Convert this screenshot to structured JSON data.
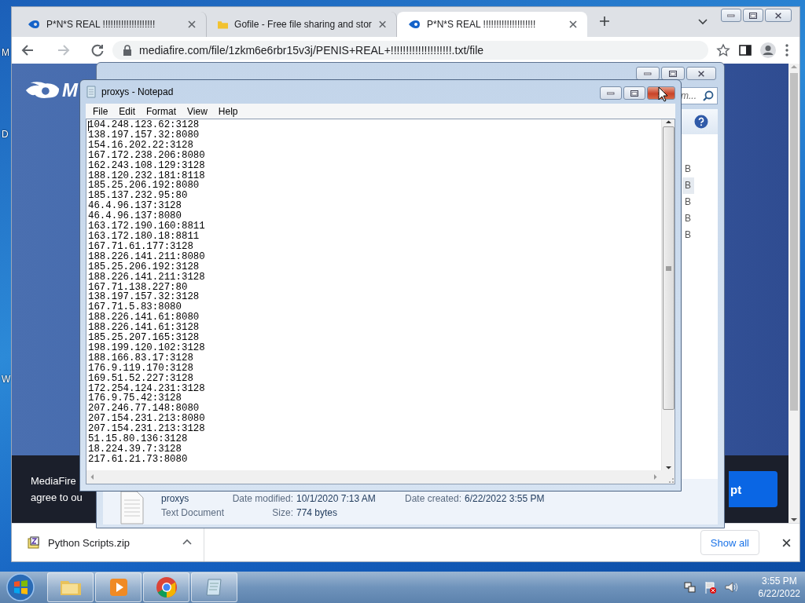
{
  "desktop": {
    "icon_labels": [
      "M",
      "D",
      "W"
    ]
  },
  "browser": {
    "tabs": [
      {
        "title": "P*N*S REAL !!!!!!!!!!!!!!!!!!!!",
        "selected": false,
        "kind": "mediafire"
      },
      {
        "title": "Gofile - Free file sharing and stor",
        "selected": false,
        "kind": "folder"
      },
      {
        "title": "P*N*S REAL !!!!!!!!!!!!!!!!!!!!",
        "selected": true,
        "kind": "mediafire"
      }
    ],
    "url": "mediafire.com/file/1zkm6e6rbr15v3j/PENIS+REAL+!!!!!!!!!!!!!!!!!!!!.txt/file",
    "page": {
      "logo": "M",
      "banner_lines": [
        "MediaFire",
        "agree to ou"
      ],
      "banner_button": "pt"
    },
    "downloads": {
      "file": "Python Scripts.zip",
      "show_all": "Show all"
    }
  },
  "explorer": {
    "search_placeholder": "m...",
    "size_fragments": [
      {
        "text": "B",
        "selected": false
      },
      {
        "text": "B",
        "selected": true
      },
      {
        "text": "B",
        "selected": false
      },
      {
        "text": "B",
        "selected": false
      },
      {
        "text": "B",
        "selected": false
      }
    ],
    "details": {
      "name": "proxys",
      "type": "Text Document",
      "modified_label": "Date modified:",
      "modified": "10/1/2020 7:13 AM",
      "created_label": "Date created:",
      "created": "6/22/2022 3:55 PM",
      "size_label": "Size:",
      "size": "774 bytes"
    }
  },
  "notepad": {
    "title": "proxys - Notepad",
    "menu": [
      "File",
      "Edit",
      "Format",
      "View",
      "Help"
    ],
    "lines": [
      "104.248.123.62:3128",
      "138.197.157.32:8080",
      "154.16.202.22:3128",
      "167.172.238.206:8080",
      "162.243.108.129:3128",
      "188.120.232.181:8118",
      "185.25.206.192:8080",
      "185.137.232.95:80",
      "46.4.96.137:3128",
      "46.4.96.137:8080",
      "163.172.190.160:8811",
      "163.172.180.18:8811",
      "167.71.61.177:3128",
      "188.226.141.211:8080",
      "185.25.206.192:3128",
      "188.226.141.211:3128",
      "167.71.138.227:80",
      "138.197.157.32:3128",
      "167.71.5.83:8080",
      "188.226.141.61:8080",
      "188.226.141.61:3128",
      "185.25.207.165:3128",
      "198.199.120.102:3128",
      "188.166.83.17:3128",
      "176.9.119.170:3128",
      "169.51.52.227:3128",
      "172.254.124.231:3128",
      "176.9.75.42:3128",
      "207.246.77.148:8080",
      "207.154.231.213:8080",
      "207.154.231.213:3128",
      "51.15.80.136:3128",
      "18.224.39.7:3128",
      "217.61.21.73:8080"
    ]
  },
  "taskbar": {
    "apps": [
      {
        "kind": "explorer"
      },
      {
        "kind": "media"
      },
      {
        "kind": "chrome"
      },
      {
        "kind": "notepad"
      }
    ],
    "time": "3:55 PM",
    "date": "6/22/2022"
  }
}
